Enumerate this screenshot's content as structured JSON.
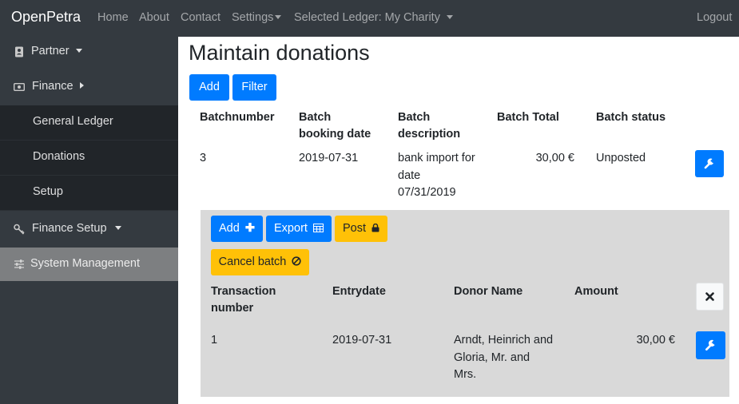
{
  "navbar": {
    "brand": "OpenPetra",
    "home": "Home",
    "about": "About",
    "contact": "Contact",
    "settings": "Settings",
    "ledger": "Selected Ledger: My Charity",
    "logout": "Logout"
  },
  "sidebar": {
    "partner": "Partner",
    "finance": "Finance",
    "general_ledger": "General Ledger",
    "donations": "Donations",
    "setup": "Setup",
    "finance_setup": "Finance Setup",
    "system_management": "System Management"
  },
  "main": {
    "title": "Maintain donations",
    "add_label": "Add",
    "filter_label": "Filter",
    "columns": {
      "batchnumber": "Batchnumber",
      "booking_date_1": "Batch",
      "booking_date_2": "booking date",
      "description_1": "Batch",
      "description_2": "description",
      "total": "Batch Total",
      "status": "Batch status"
    },
    "batch": {
      "number": "3",
      "booking_date": "2019-07-31",
      "description_1": "bank import for",
      "description_2": "date",
      "description_3": "07/31/2019",
      "total": "30,00 €",
      "status": "Unposted"
    }
  },
  "batch_detail": {
    "add_label": "Add",
    "export_label": "Export",
    "post_label": "Post",
    "cancel_label": "Cancel batch",
    "columns": {
      "transaction_1": "Transaction",
      "transaction_2": "number",
      "entrydate": "Entrydate",
      "donor": "Donor Name",
      "amount": "Amount"
    },
    "row": {
      "number": "1",
      "entrydate": "2019-07-31",
      "donor_1": "Arndt, Heinrich and",
      "donor_2": "Gloria, Mr. and",
      "donor_3": "Mrs.",
      "amount": "30,00 €"
    }
  },
  "colors": {
    "navbar": "#343a40",
    "primary": "#007bff",
    "warning": "#ffc107",
    "detail_panel": "#d9d9d9"
  },
  "icons": [
    "address-book-icon",
    "money-bill-icon",
    "key-icon",
    "sliders-icon",
    "wrench-icon",
    "plus-icon",
    "table-icon",
    "lock-icon",
    "ban-icon",
    "close-icon"
  ]
}
